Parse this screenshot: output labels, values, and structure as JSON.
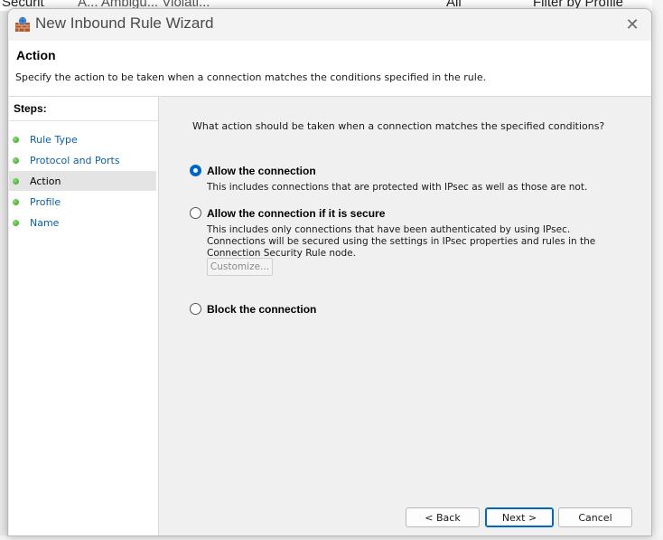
{
  "background": {
    "left_text": "Securit",
    "middle_text": "A... Ambigu... Violati...",
    "right_text": "All",
    "far_right_text": "Filter by Profile"
  },
  "window": {
    "title": "New Inbound Rule Wizard",
    "close_glyph": "✕"
  },
  "header": {
    "title": "Action",
    "description": "Specify the action to be taken when a connection matches the conditions specified in the rule."
  },
  "steps": {
    "heading": "Steps:",
    "items": [
      {
        "label": "Rule Type",
        "current": false
      },
      {
        "label": "Protocol and Ports",
        "current": false
      },
      {
        "label": "Action",
        "current": true
      },
      {
        "label": "Profile",
        "current": false
      },
      {
        "label": "Name",
        "current": false
      }
    ]
  },
  "content": {
    "question": "What action should be taken when a connection matches the specified conditions?",
    "options": [
      {
        "label": "Allow the connection",
        "description": "This includes connections that are protected with IPsec as well as those are not.",
        "selected": true
      },
      {
        "label": "Allow the connection if it is secure",
        "description": "This includes only connections that have been authenticated by using IPsec.  Connections will be secured using the settings in IPsec properties and rules in the Connection Security Rule node.",
        "selected": false
      },
      {
        "label": "Block the connection",
        "description": "",
        "selected": false
      }
    ],
    "customize_label": "Customize..."
  },
  "buttons": {
    "back": "< Back",
    "next": "Next >",
    "cancel": "Cancel"
  },
  "colors": {
    "accent": "#0067c0",
    "step_link": "#0b5fa8",
    "step_dot": "#2f9a1c"
  }
}
